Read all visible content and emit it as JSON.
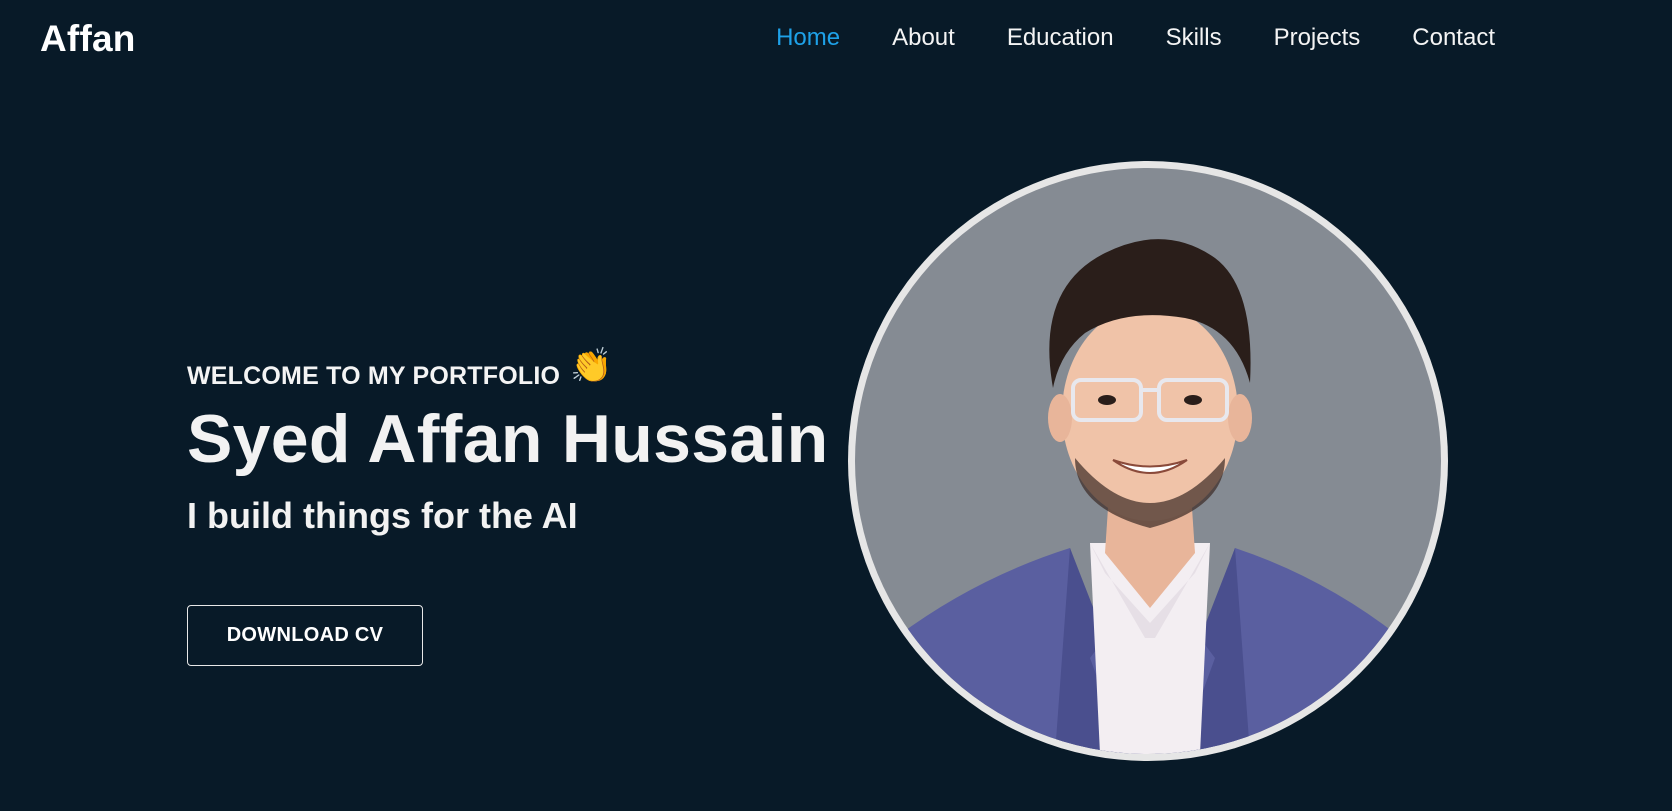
{
  "brand": "Affan",
  "nav": {
    "items": [
      {
        "label": "Home",
        "active": true
      },
      {
        "label": "About"
      },
      {
        "label": "Education"
      },
      {
        "label": "Skills"
      },
      {
        "label": "Projects"
      },
      {
        "label": "Contact"
      }
    ]
  },
  "hero": {
    "welcome": "WELCOME TO MY PORTFOLIO",
    "wave_icon": "👏",
    "name": "Syed Affan Hussain",
    "tagline": "I build things for the AI",
    "cv_button": "DOWNLOAD CV"
  },
  "colors": {
    "background": "#081a28",
    "accent": "#1ea1e8",
    "text": "#f2f2f2",
    "avatar_bg": "#858b93",
    "avatar_ring": "#e6e6e6"
  },
  "icons": {
    "wave": "waving-hand-icon",
    "profile": "profile-photo"
  }
}
